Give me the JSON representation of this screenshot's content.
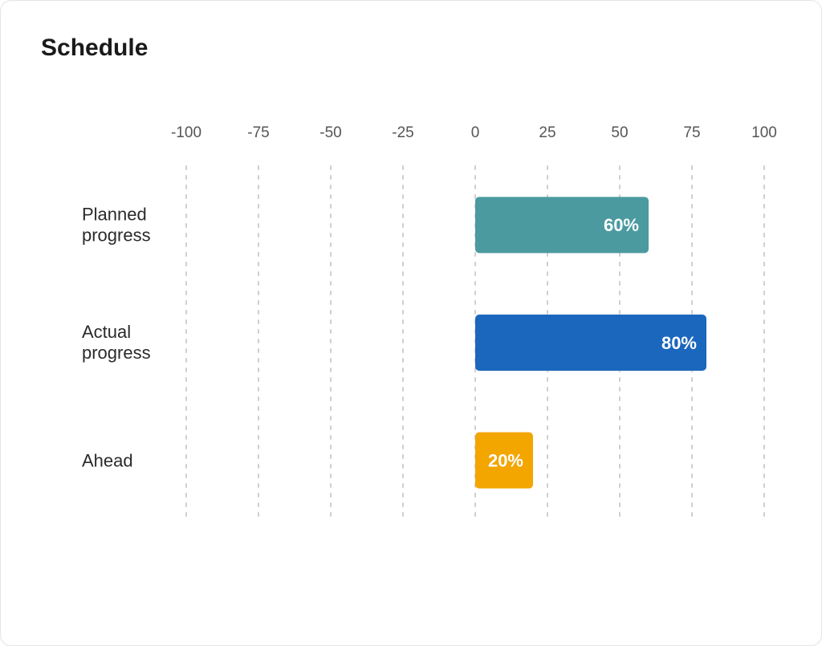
{
  "title": "Schedule",
  "chart_data": {
    "type": "bar",
    "orientation": "horizontal",
    "categories": [
      "Planned progress",
      "Actual progress",
      "Ahead"
    ],
    "values": [
      60,
      80,
      20
    ],
    "value_labels": [
      "60%",
      "80%",
      "20%"
    ],
    "colors": [
      "#4b9aa0",
      "#1a67bd",
      "#f3a500"
    ],
    "xlim": [
      -100,
      100
    ],
    "x_ticks": [
      -100,
      -75,
      -50,
      -25,
      0,
      25,
      50,
      75,
      100
    ],
    "x_tick_labels": [
      "-100",
      "-75",
      "-50",
      "-25",
      "0",
      "25",
      "50",
      "75",
      "100"
    ],
    "title": "Schedule",
    "grid": true
  }
}
